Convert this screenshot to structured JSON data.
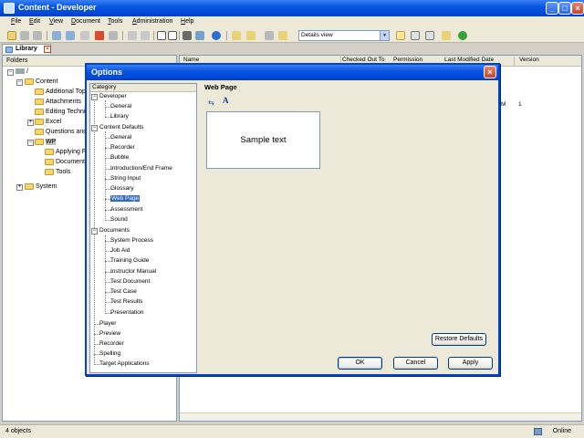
{
  "window": {
    "title": "Content - Developer"
  },
  "menu": [
    "File",
    "Edit",
    "View",
    "Document",
    "Tools",
    "Administration",
    "Help"
  ],
  "toolbar": {
    "view_select": "Details view"
  },
  "tab": {
    "label": "Library"
  },
  "folders": {
    "header": "Folders",
    "root": "/",
    "content": "Content",
    "items": [
      "Additional Top",
      "Attachments",
      "Editing Techni",
      "Excel",
      "Questions and",
      "WP"
    ],
    "wp_children": [
      "Applying F",
      "Document",
      "Tools"
    ],
    "system": "System"
  },
  "list": {
    "columns": [
      "Name",
      "Checked Out To",
      "Permission",
      "Last Modified Date",
      "Version"
    ],
    "row_fragment": "M",
    "row_version": "1"
  },
  "status": {
    "left": "4 objects",
    "right": "Online"
  },
  "dialog": {
    "title": "Options",
    "category_header": "Category",
    "categories": {
      "developer": "Developer",
      "developer_items": [
        "General",
        "Library"
      ],
      "content_defaults": "Content Defaults",
      "content_items": [
        "General",
        "Recorder",
        "Bubble",
        "Introduction/End Frame",
        "String Input",
        "Glossary",
        "Web Page",
        "Assessment",
        "Sound"
      ],
      "documents": "Documents",
      "document_items": [
        "System Process",
        "Job Aid",
        "Training Guide",
        "Instructor Manual",
        "Test Document",
        "Test Case",
        "Test Results",
        "Presentation"
      ],
      "other": [
        "Player",
        "Preview",
        "Recorder",
        "Spelling",
        "Target Applications"
      ]
    },
    "settings_title": "Web Page",
    "sample_text": "Sample text",
    "buttons": {
      "restore": "Restore Defaults",
      "ok": "OK",
      "cancel": "Cancel",
      "apply": "Apply"
    }
  }
}
